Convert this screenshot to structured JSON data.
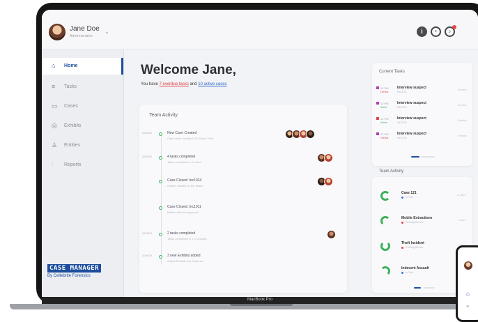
{
  "user": {
    "name": "Jane Doe",
    "role": "Administrator"
  },
  "topbar_icons": [
    "info-icon",
    "settings-icon",
    "bell-icon"
  ],
  "sidebar": {
    "items": [
      {
        "label": "Home",
        "icon": "home-icon",
        "active": true
      },
      {
        "label": "Tasks",
        "icon": "tasks-icon"
      },
      {
        "label": "Cases",
        "icon": "cases-icon"
      },
      {
        "label": "Exhibits",
        "icon": "exhibits-icon"
      },
      {
        "label": "Entities",
        "icon": "entities-icon"
      },
      {
        "label": "Reports",
        "icon": "reports-icon"
      }
    ],
    "brand_title": "CASE MANAGER",
    "brand_sub": "By Cellebrite Forensics"
  },
  "main": {
    "welcome": "Welcome Jane,",
    "summary_prefix": "You have ",
    "overdue": "7 overdue tasks",
    "summary_mid": " and ",
    "active_cases": "10 active cases"
  },
  "team_activity": {
    "title": "Team Activity",
    "items": [
      {
        "date": "23 AUG",
        "title": "New Case Created",
        "desc": "Case name: Incident 102 Taylor Theft"
      },
      {
        "date": "10 NOV",
        "title": "4 tasks completed",
        "desc": "Tasks completed in 2 cases"
      },
      {
        "date": "",
        "title": "Case Closed: Inc1024",
        "desc": "Closed: assault on the beach"
      },
      {
        "date": "",
        "title": "Case Closed: Inc1011",
        "desc": "Bofmix ditter for approval"
      },
      {
        "date": "10 NOV",
        "title": "2 tasks completed",
        "desc": "Tasks completed in 1 of 3 cases"
      },
      {
        "date": "10 NOV",
        "title": "3 new Exhibits added",
        "desc": "Added Exhibits into Evidence"
      }
    ]
  },
  "current_tasks": {
    "title": "Current Tasks",
    "items": [
      {
        "time": "12 PM",
        "tag": "Ovrdue",
        "title": "Interview suspect",
        "case": "INC4701",
        "status": "Overdue",
        "color": "#b23fb0",
        "tag_color": "#e0454c"
      },
      {
        "time": "12 PM",
        "tag": "Active",
        "title": "Interview suspect",
        "case": "INC4710",
        "status": "Overdue",
        "color": "#b23fb0",
        "tag_color": "#3cb15b"
      },
      {
        "time": "12 PM",
        "tag": "Active",
        "title": "Interview suspect",
        "case": "INC4720",
        "status": "Overdue",
        "color": "#e0454c",
        "tag_color": "#3cb15b"
      },
      {
        "time": "12 PM",
        "tag": "Ovrdue",
        "title": "Interview suspect",
        "case": "INC4731",
        "status": "Overdue",
        "color": "#b23fb0",
        "tag_color": "#e0454c"
      }
    ]
  },
  "team_activity_2": {
    "title": "Team Activity",
    "items": [
      {
        "title": "Case 121",
        "sub": "In Trial",
        "time": "12 days",
        "dot": "#3c7bd6",
        "progress": 0.75
      },
      {
        "title": "Mobile Extractions",
        "sub": "Pending Review",
        "time": "5 days",
        "dot": "#e0454c",
        "progress": 0.6
      },
      {
        "title": "Theft Incident",
        "sub": "Pending Review",
        "time": "2 days",
        "dot": "#e0454c",
        "progress": 0.85
      },
      {
        "title": "Indecent Assault",
        "sub": "In Trial",
        "time": "1 day",
        "dot": "#3c7bd6",
        "progress": 0.4
      }
    ]
  },
  "laptop_label": "MacBook Pro",
  "colors": {
    "accent": "#1d4e9e",
    "overdue": "#e03a3a",
    "link": "#2c67c8",
    "success": "#3cb15b"
  }
}
